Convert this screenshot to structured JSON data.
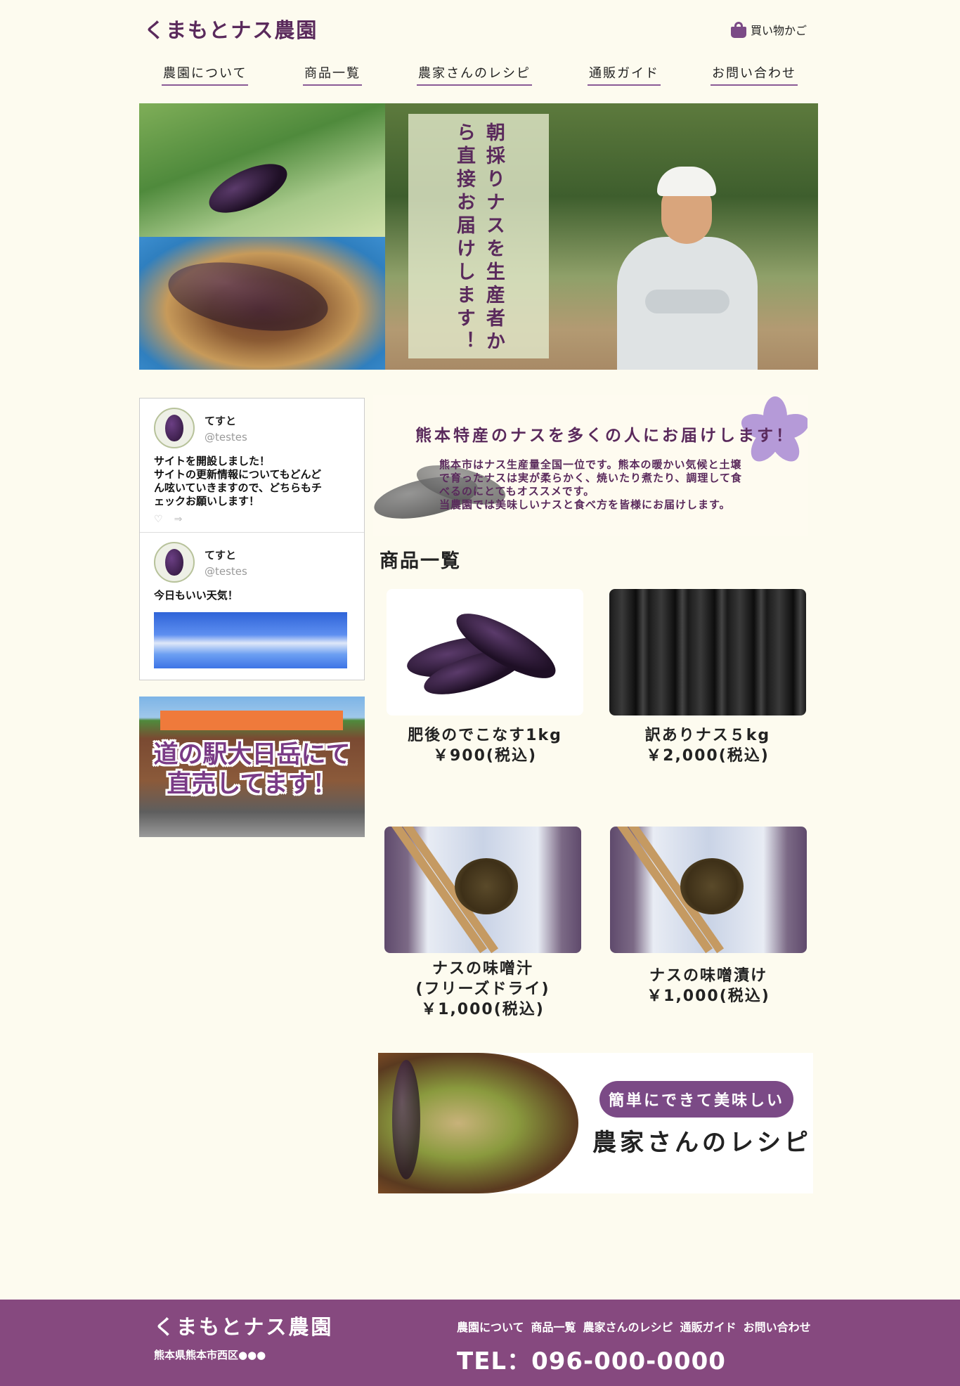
{
  "header": {
    "logo": "くまもとナス農園",
    "cart_label": "買い物かご"
  },
  "nav": [
    "農園について",
    "商品一覧",
    "農家さんのレシピ",
    "通販ガイド",
    "お問い合わせ"
  ],
  "hero": {
    "copy": "朝採りナスを生産者から直接お届けします！"
  },
  "timeline": {
    "tweets": [
      {
        "name": "てすと",
        "handle": "@testes",
        "text": "サイトを開設しました！\nサイトの更新情報についてもどんど\nん呟いていきますので、どちらもチ\nェックお願いします！",
        "like_icon": "♡",
        "share_icon": "⇒"
      },
      {
        "name": "てすと",
        "handle": "@testes",
        "text": "今日もいい天気！"
      }
    ]
  },
  "station_banner": {
    "line1": "道の駅大日岳にて",
    "line2": "直売してます！"
  },
  "intro": {
    "title": "熊本特産のナスを多くの人にお届けします！",
    "body": "熊本市はナス生産量全国一位です。熊本の暖かい気候と土壌\nで育ったナスは実が柔らかく、焼いたり煮たり、調理して食\nべるのにとてもオススメです。\n当農園では美味しいナスと食べ方を皆様にお届けします。"
  },
  "products_section": {
    "title": "商品一覧",
    "items": [
      {
        "name": "肥後のでこなす1kg",
        "price": "￥900(税込)"
      },
      {
        "name": "訳ありナス５kg",
        "price": "￥2,000(税込)"
      },
      {
        "name": "ナスの味噌汁\n(フリーズドライ)",
        "price": "￥1,000(税込)"
      },
      {
        "name": "ナスの味噌漬け",
        "price": "￥1,000(税込)"
      }
    ]
  },
  "recipe_banner": {
    "tag": "簡単にできて美味しい",
    "title": "農家さんのレシピ"
  },
  "footer": {
    "logo": "くまもとナス農園",
    "address": "熊本県熊本市西区●●●",
    "links": [
      "農園について",
      "商品一覧",
      "農家さんのレシピ",
      "通販ガイド",
      "お問い合わせ"
    ],
    "tel": "TEL：096-000-0000"
  },
  "colors": {
    "background": "#fdfbef",
    "brand_purple": "#86497f",
    "text_purple": "#5a2a5c"
  }
}
